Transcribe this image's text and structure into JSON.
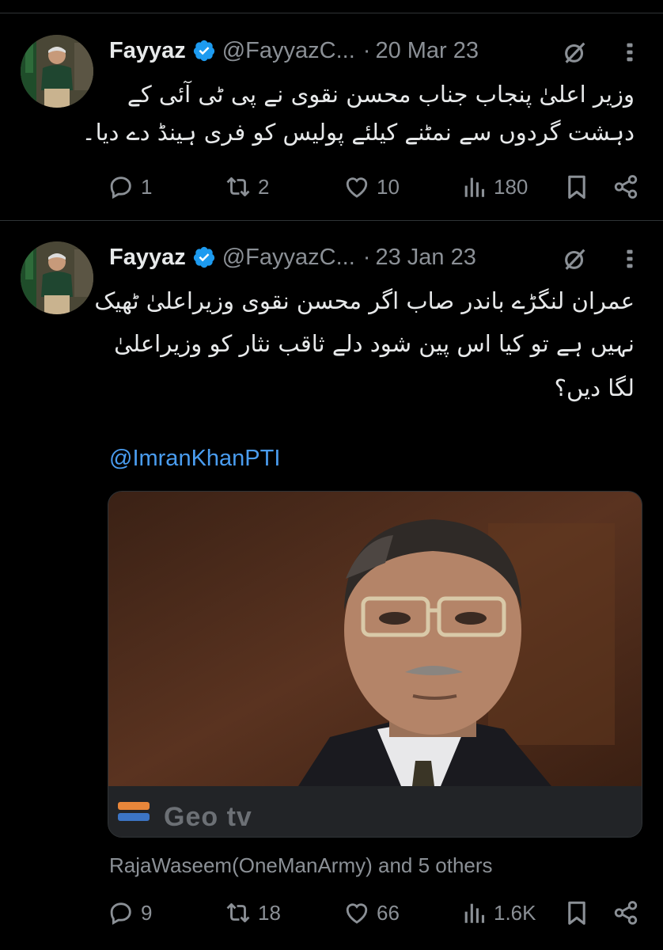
{
  "tweets": [
    {
      "author": {
        "name": "Fayyaz",
        "handle": "@FayyazC...",
        "verified": true
      },
      "date": "20 Mar 23",
      "text_lines": [
        "وزیر اعلیٰ پنجاب جناب محسن نقوی نے پی ٹی آئی کے",
        "دہشت گردوں سے نمٹنے کیلئے پولیس کو فری ہینڈ دے دیا۔"
      ],
      "actions": {
        "replies": "1",
        "reposts": "2",
        "likes": "10",
        "views": "180"
      }
    },
    {
      "author": {
        "name": "Fayyaz",
        "handle": "@FayyazC...",
        "verified": true
      },
      "date": "23 Jan 23",
      "text_lines": [
        "عمران لنگڑے باندر صاب اگر محسن نقوی وزیراعلیٰ ٹھیک",
        "نہیں ہے تو کیا اس پین شود دلے ثاقب نثار کو وزیراعلیٰ",
        "لگا دیں؟"
      ],
      "mention": "@ImranKhanPTI",
      "media": {
        "source_label": "Geo tv"
      },
      "liked_by": "RajaWaseem(OneManArmy) and 5 others",
      "actions": {
        "replies": "9",
        "reposts": "18",
        "likes": "66",
        "views": "1.6K"
      }
    }
  ],
  "icons": {
    "verified": "verified-badge-icon",
    "grok": "grok-icon",
    "more": "more-icon",
    "reply": "reply-icon",
    "repost": "repost-icon",
    "like": "heart-icon",
    "views": "views-icon",
    "bookmark": "bookmark-icon",
    "share": "share-icon"
  },
  "colors": {
    "background": "#000000",
    "text": "#e7e9ea",
    "secondary": "#8b9096",
    "link": "#4a9df0",
    "verified": "#1d9bf0",
    "divider": "#2f3336"
  }
}
